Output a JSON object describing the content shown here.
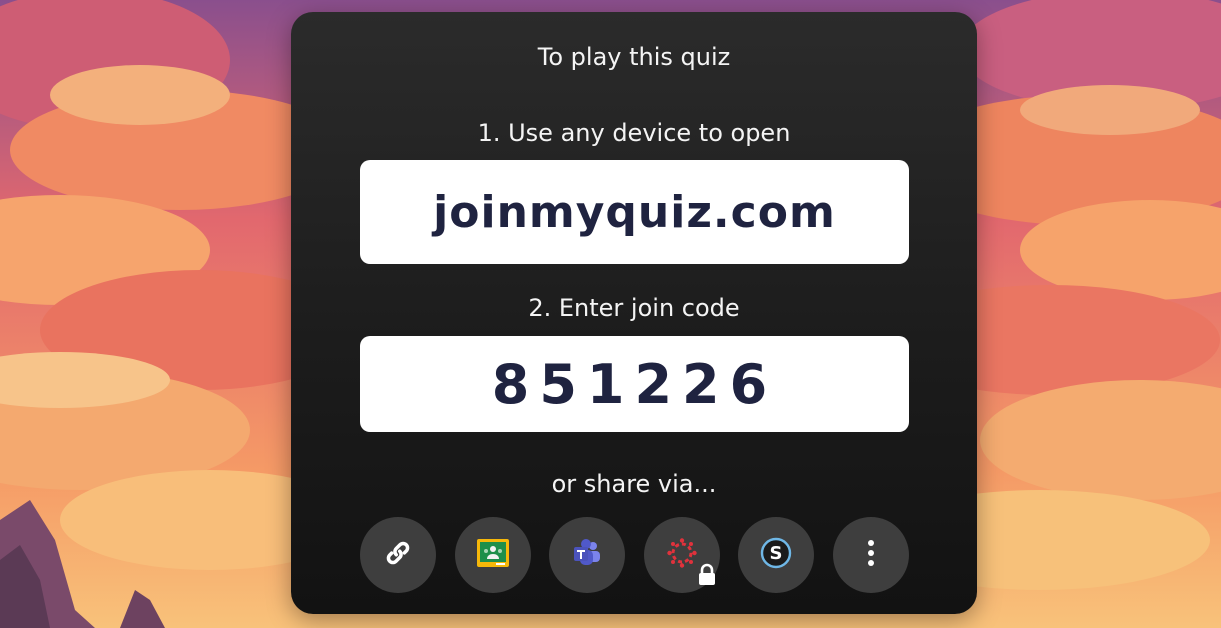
{
  "card": {
    "heading": "To play this quiz",
    "step1_label": "1. Use any device to open",
    "url": "joinmyquiz.com",
    "step2_label": "2. Enter join code",
    "join_code": "851226",
    "share_label": "or share via..."
  },
  "share_buttons": [
    {
      "icon": "link-icon"
    },
    {
      "icon": "google-classroom-icon"
    },
    {
      "icon": "microsoft-teams-icon"
    },
    {
      "icon": "canvas-lms-icon",
      "locked": true
    },
    {
      "icon": "schoology-icon"
    },
    {
      "icon": "more-vertical-icon"
    }
  ],
  "colors": {
    "card_bg": "#1c1c1c",
    "panel_text": "#1f2340",
    "share_button_bg": "#3e3e3e"
  }
}
